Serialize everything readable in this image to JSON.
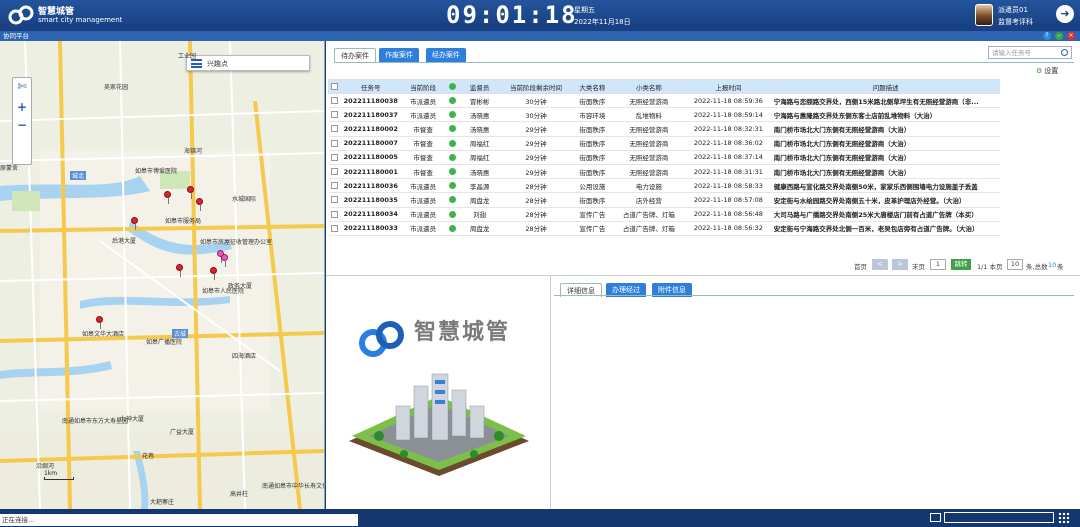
{
  "header": {
    "app_title": "智慧城管",
    "app_subtitle": "smart city management",
    "clock": "09:01:18",
    "weekday": "星期五",
    "date": "2022年11月18日",
    "user_name": "派遣员01",
    "user_role": "监督考评科"
  },
  "subbar": {
    "title": "协同平台"
  },
  "map": {
    "search_label": "兴趣点",
    "scale": "1km",
    "labels": [
      "吴家花园",
      "城北",
      "原蒙舍",
      "如皋市博爱医院",
      "如皋市服务局",
      "后港大厦",
      "海锦河",
      "如皋市人民医院",
      "水城国际",
      "政务大厦",
      "如皋文华大酒店",
      "如皋广播医院",
      "南通如皋市东方大寿星园",
      "力神大厦",
      "广益大厦",
      "花巷",
      "大耙寨庄",
      "高井柱",
      "南通如皋市中华长寿文化公园",
      "如皋市房屋征收管理办公室",
      "工业园",
      "沿绸河",
      "四海酒店",
      "古城"
    ]
  },
  "tabs_top": [
    "待办案件",
    "作废案件",
    "经办案件"
  ],
  "task_search_placeholder": "请输入任务号",
  "settings_label": "设置",
  "table": {
    "headers": [
      "任务号",
      "当前阶段",
      "",
      "监督员",
      "当前阶段剩余时间",
      "大类名称",
      "小类名称",
      "上报时间",
      "问题描述"
    ],
    "rows": [
      [
        "202211180038",
        "市派遣员",
        "",
        "冒彬彬",
        "30分钟",
        "街面秩序",
        "无照经营游商",
        "2022-11-18 08:59:36",
        "宁海路与恋颐路交界处，西侧15米路北侧草坪生有无照经营游商（非..."
      ],
      [
        "202211180037",
        "市派遣员",
        "",
        "汤晓惠",
        "30分钟",
        "市容环境",
        "乱堆物料",
        "2022-11-18 08:59:14",
        "宁海路与惠隆路交界处东侧东客士店前乱堆物料（大治）"
      ],
      [
        "202211180002",
        "市督查",
        "",
        "汤晓惠",
        "29分钟",
        "街面秩序",
        "无照经营游商",
        "2022-11-18 08:32:31",
        "南门桥市场北大门东侧有无照经营游商（大治）"
      ],
      [
        "202211180007",
        "市督查",
        "",
        "周福红",
        "29分钟",
        "街面秩序",
        "无照经营游商",
        "2022-11-18 08:36:02",
        "南门桥市场北大门东侧有无照经营游商（大治）"
      ],
      [
        "202211180005",
        "市督查",
        "",
        "周福红",
        "29分钟",
        "街面秩序",
        "无照经营游商",
        "2022-11-18 08:37:14",
        "南门桥市场北大门东侧有无照经营游商（大治）"
      ],
      [
        "202211180001",
        "市督查",
        "",
        "汤晓惠",
        "29分钟",
        "街面秩序",
        "无照经营游商",
        "2022-11-18 08:31:31",
        "南门桥市场北大门东侧有无照经营游商（大治）"
      ],
      [
        "202211180036",
        "市派遣员",
        "",
        "李晶源",
        "28分钟",
        "公用设施",
        "电力设施",
        "2022-11-18 08:58:33",
        "健康西路与宣化路交界处南侧50米，家家乐西侧围墙电力设施盖子丢盖"
      ],
      [
        "202211180035",
        "市派遣员",
        "",
        "周盘龙",
        "28分钟",
        "街面秩序",
        "店外经营",
        "2022-11-18 08:57:08",
        "安定街与水绘园路交界处南侧五十米，皮革护理店外经营。（大治）"
      ],
      [
        "202211180034",
        "市派遣员",
        "",
        "刘翅",
        "28分钟",
        "宣传广告",
        "占道广告牌、灯箱",
        "2022-11-18 08:56:48",
        "大司马路与广播路交界处南侧25米大唐楼店门前有占道广告牌（本买）"
      ],
      [
        "202211180033",
        "市派遣员",
        "",
        "周盘龙",
        "28分钟",
        "宣传广告",
        "占道广告牌、灯箱",
        "2022-11-18 08:56:32",
        "安定街与宁海路交界处北侧一百米，老吴包店旁有占道广告牌。（大治）"
      ]
    ]
  },
  "pager": {
    "first": "首页",
    "prev": "<",
    "next": ">",
    "last": "末页",
    "page_input": "1",
    "go": "跳转",
    "page_info": "1/1 本页",
    "per_page": "10",
    "total_text": "条,总数",
    "total": "10",
    "unit": "条"
  },
  "brand": {
    "title": "智慧城管"
  },
  "tabs_bottom": [
    "详细信息",
    "办理经过",
    "附件信息"
  ],
  "footer": {
    "status": "正在连接..."
  }
}
